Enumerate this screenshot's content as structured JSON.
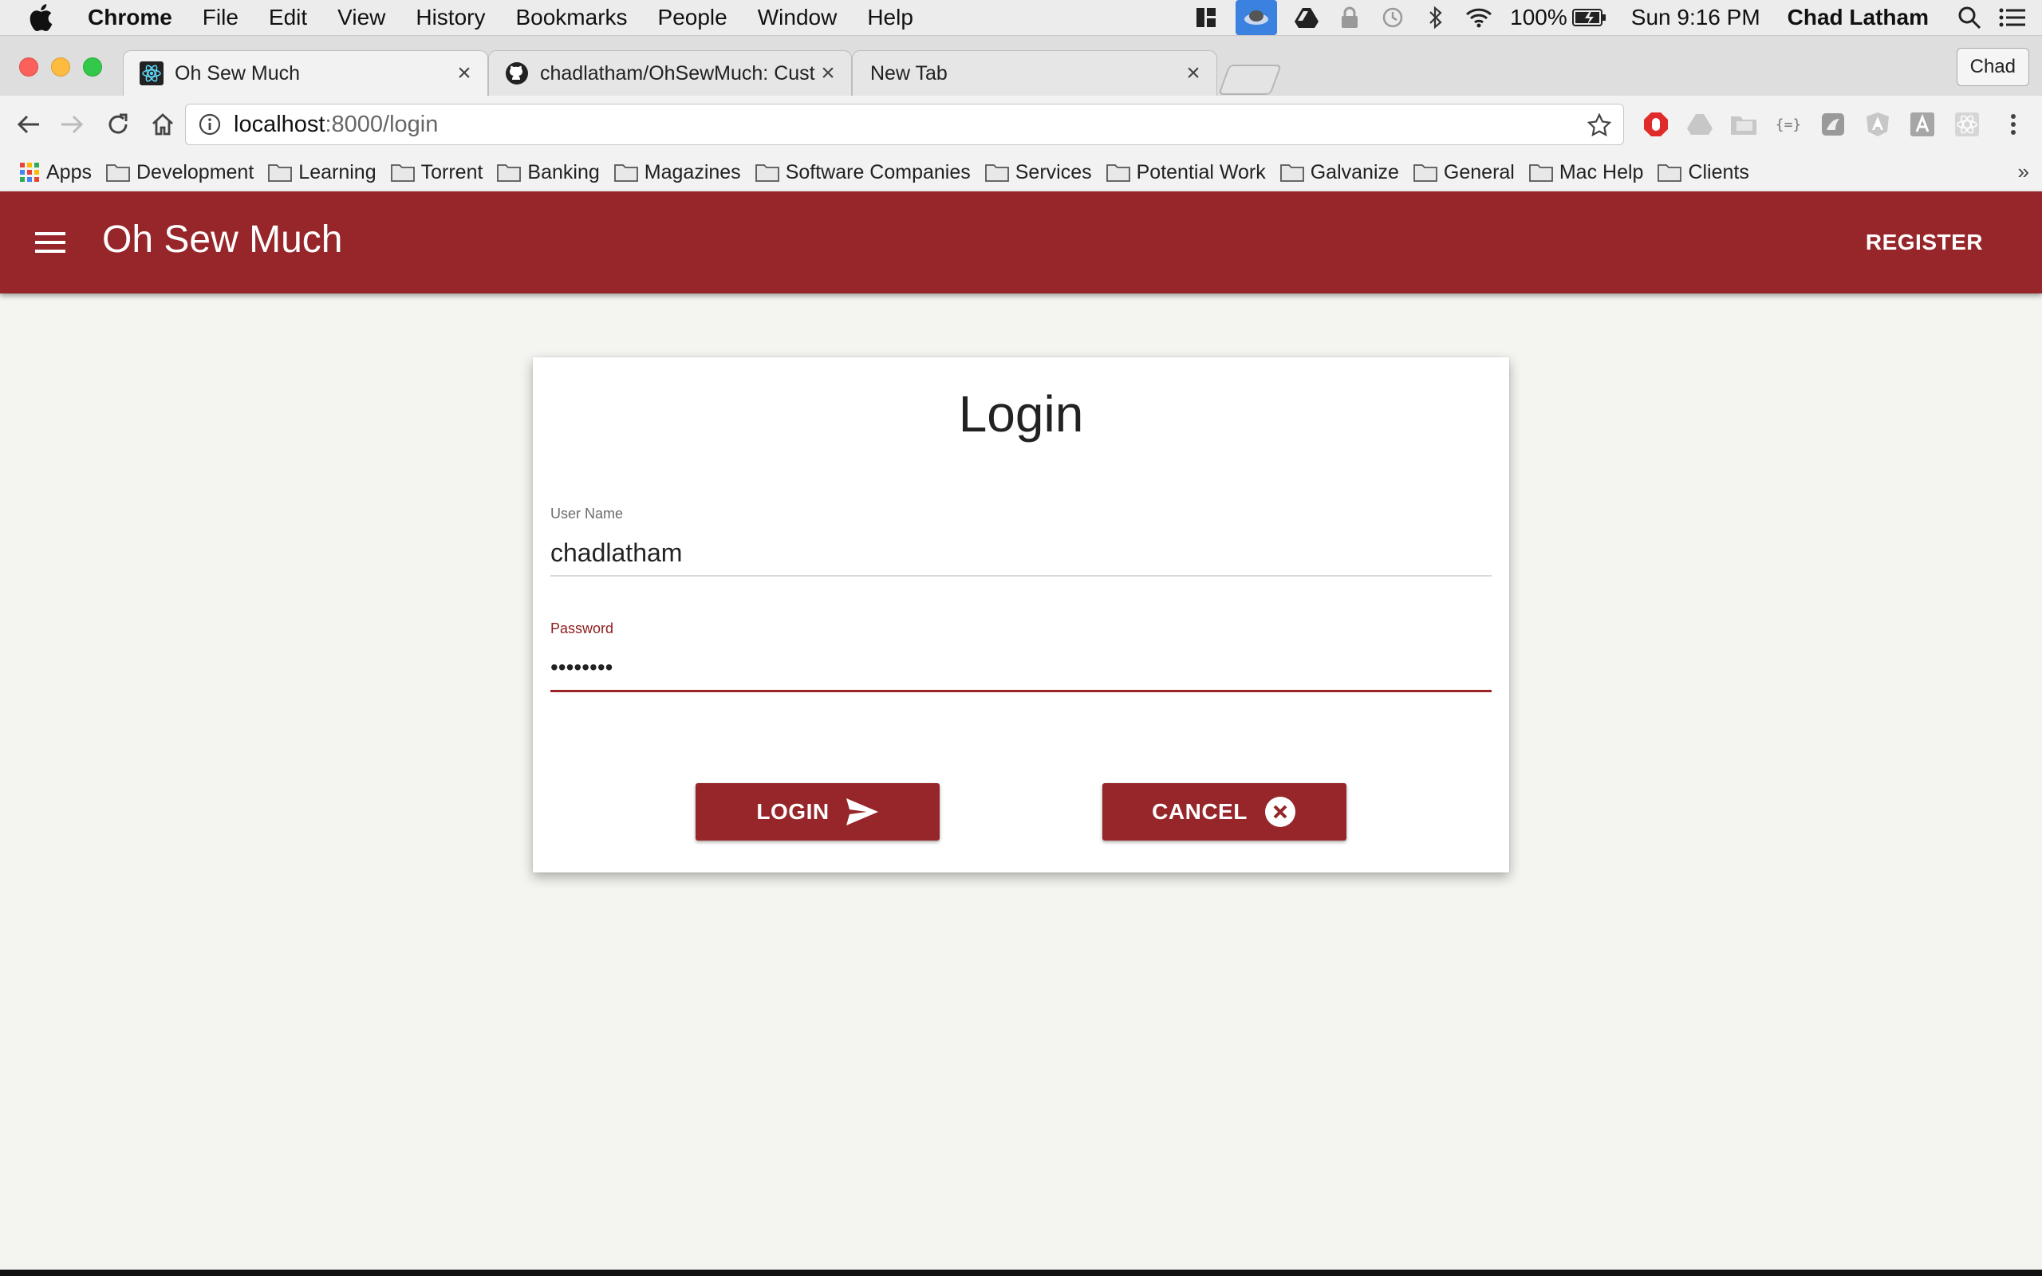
{
  "menubar": {
    "app_name": "Chrome",
    "items": [
      "File",
      "Edit",
      "View",
      "History",
      "Bookmarks",
      "People",
      "Window",
      "Help"
    ],
    "battery": "100%",
    "clock": "Sun 9:16 PM",
    "user": "Chad Latham"
  },
  "browser": {
    "tabs": [
      {
        "title": "Oh Sew Much",
        "icon": "react-icon"
      },
      {
        "title": "chadlatham/OhSewMuch: Cust",
        "icon": "github-icon"
      },
      {
        "title": "New Tab",
        "icon": ""
      }
    ],
    "profile": "Chad",
    "url_host": "localhost",
    "url_path": ":8000/login"
  },
  "bookmarks": {
    "apps_label": "Apps",
    "folders": [
      "Development",
      "Learning",
      "Torrent",
      "Banking",
      "Magazines",
      "Software Companies",
      "Services",
      "Potential Work",
      "Galvanize",
      "General",
      "Mac Help",
      "Clients"
    ],
    "more": "»"
  },
  "app": {
    "title": "Oh Sew Much",
    "register_label": "REGISTER",
    "accent_color": "#962629"
  },
  "login": {
    "title": "Login",
    "username_label": "User Name",
    "username_value": "chadlatham",
    "password_label": "Password",
    "password_value": "12345678",
    "login_label": "LOGIN",
    "cancel_label": "CANCEL"
  }
}
